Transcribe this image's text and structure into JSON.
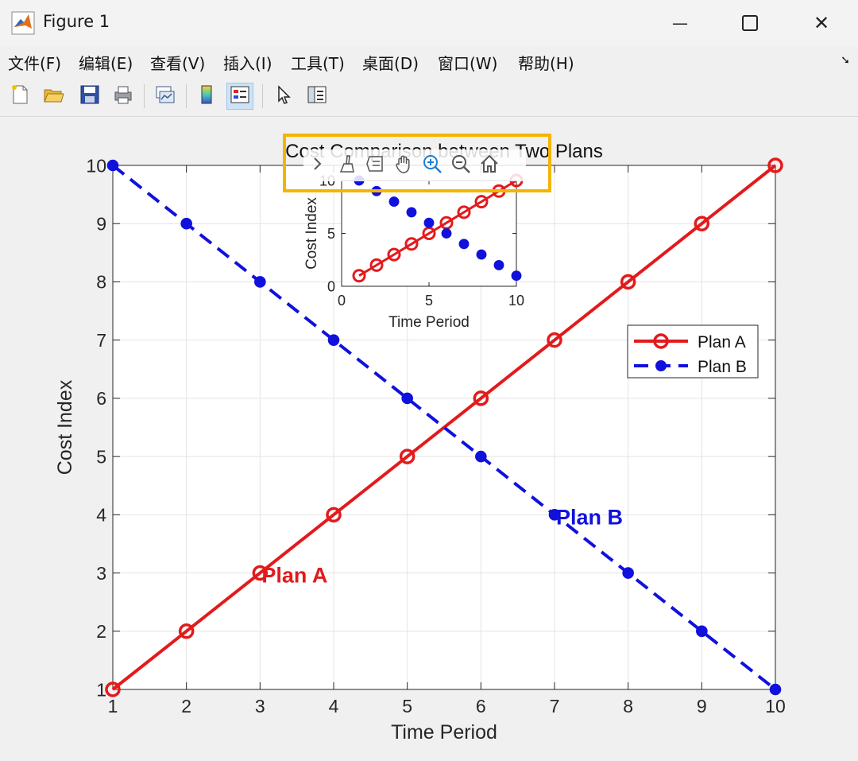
{
  "window": {
    "title": "Figure 1",
    "minimize_glyph": "—",
    "close_glyph": "✕"
  },
  "menu": [
    {
      "label": "文件(F)"
    },
    {
      "label": "编辑(E)"
    },
    {
      "label": "查看(V)"
    },
    {
      "label": "插入(I)"
    },
    {
      "label": "工具(T)"
    },
    {
      "label": "桌面(D)"
    },
    {
      "label": "窗口(W)"
    },
    {
      "label": "帮助(H)"
    }
  ],
  "toolbar": {
    "icons": [
      "new-figure-icon",
      "open-file-icon",
      "save-icon",
      "print-icon",
      "link-plot-icon",
      "colorbar-icon",
      "legend-icon",
      "edit-plot-icon",
      "property-inspector-icon"
    ],
    "active": "legend-icon"
  },
  "axes_toolbar": {
    "icons": [
      "expand-icon",
      "brush-icon",
      "data-tips-icon",
      "pan-icon",
      "zoom-in-icon",
      "zoom-out-icon",
      "home-icon"
    ],
    "active": "zoom-in-icon"
  },
  "colors": {
    "plan_a": "#e31a1c",
    "plan_b": "#1111dd",
    "highlight": "#f4b400"
  },
  "chart_data": [
    {
      "type": "line",
      "title": "Cost Comparison between Two Plans",
      "xlabel": "Time Period",
      "ylabel": "Cost Index",
      "xlim": [
        1,
        10
      ],
      "ylim": [
        1,
        10
      ],
      "xticks": [
        1,
        2,
        3,
        4,
        5,
        6,
        7,
        8,
        9,
        10
      ],
      "yticks": [
        1,
        2,
        3,
        4,
        5,
        6,
        7,
        8,
        9,
        10
      ],
      "grid": true,
      "legend": "right",
      "x": [
        1,
        2,
        3,
        4,
        5,
        6,
        7,
        8,
        9,
        10
      ],
      "series": [
        {
          "name": "Plan A",
          "values": [
            1,
            2,
            3,
            4,
            5,
            6,
            7,
            8,
            9,
            10
          ],
          "style": "solid",
          "marker": "circle-open",
          "color": "#e31a1c"
        },
        {
          "name": "Plan B",
          "values": [
            10,
            9,
            8,
            7,
            6,
            5,
            4,
            3,
            2,
            1
          ],
          "style": "dashed",
          "marker": "circle-filled",
          "color": "#1111dd"
        }
      ],
      "annotations": [
        {
          "text": "Plan A",
          "x": 3,
          "y": 3,
          "color": "#e31a1c"
        },
        {
          "text": "Plan B",
          "x": 7,
          "y": 4,
          "color": "#1111dd"
        }
      ]
    },
    {
      "type": "line",
      "title": "",
      "xlabel": "Time Period",
      "ylabel": "Cost Index",
      "xlim": [
        0,
        10
      ],
      "ylim": [
        0,
        10
      ],
      "xticks": [
        0,
        5,
        10
      ],
      "yticks": [
        0,
        5,
        10
      ],
      "grid": false,
      "x": [
        1,
        2,
        3,
        4,
        5,
        6,
        7,
        8,
        9,
        10
      ],
      "series": [
        {
          "values": [
            1,
            2,
            3,
            4,
            5,
            6,
            7,
            8,
            9,
            10
          ],
          "style": "solid",
          "marker": "circle-open",
          "color": "#e31a1c"
        },
        {
          "values": [
            10,
            9,
            8,
            7,
            6,
            5,
            4,
            3,
            2,
            1
          ],
          "style": "none",
          "marker": "circle-filled",
          "color": "#1111dd"
        }
      ]
    }
  ]
}
